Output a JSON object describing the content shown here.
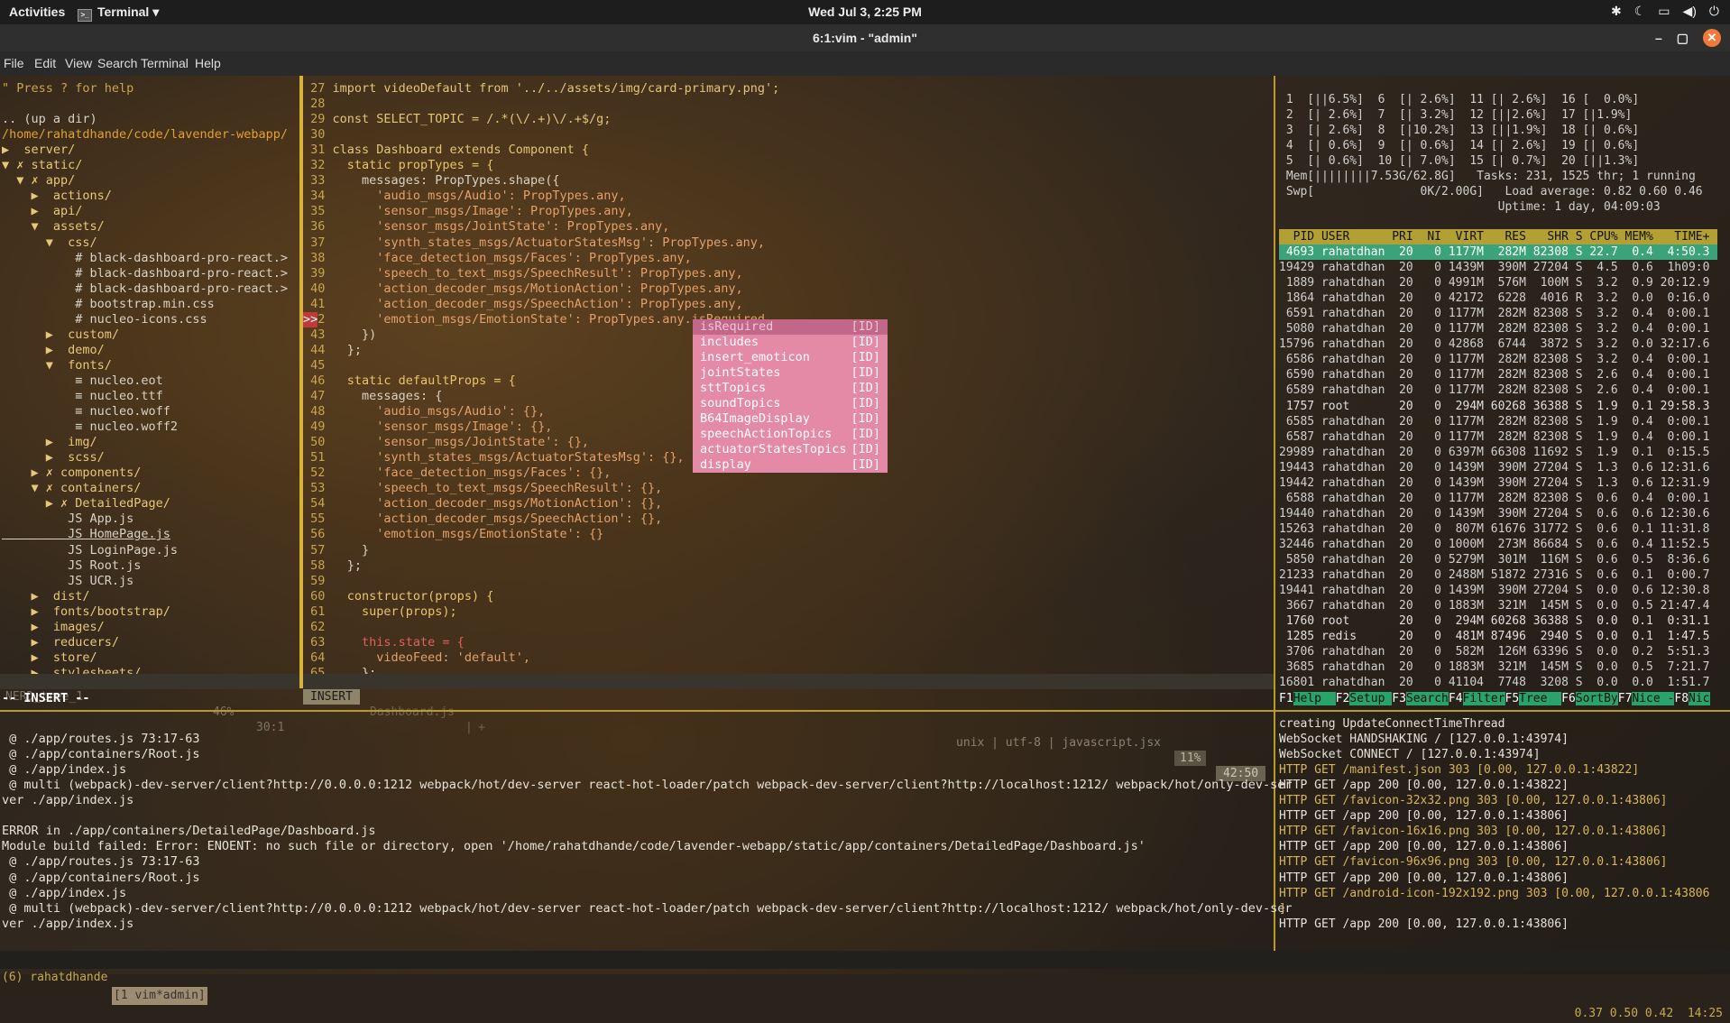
{
  "topbar": {
    "activities": "Activities",
    "app": "Terminal",
    "clock": "Wed Jul 3,  2:25 PM"
  },
  "window": {
    "title": "6:1:vim - \"admin\""
  },
  "menu": [
    "File",
    "Edit",
    "View",
    "Search",
    "Terminal",
    "Help"
  ],
  "nerdtree": {
    "lines": [
      "\" Press ? for help",
      "",
      ".. (up a dir)",
      "/home/rahatdhande/code/lavender-webapp/",
      "▶  server/",
      "▼ ✗ static/",
      "  ▼ ✗ app/",
      "    ▶  actions/",
      "    ▶  api/",
      "    ▼  assets/",
      "      ▼  css/",
      "          # black-dashboard-pro-react.>",
      "          # black-dashboard-pro-react.>",
      "          # black-dashboard-pro-react.>",
      "          # bootstrap.min.css",
      "          # nucleo-icons.css",
      "      ▶  custom/",
      "      ▶  demo/",
      "      ▼  fonts/",
      "          ≡ nucleo.eot",
      "          ≡ nucleo.ttf",
      "          ≡ nucleo.woff",
      "          ≡ nucleo.woff2",
      "      ▶  img/",
      "      ▶  scss/",
      "    ▶ ✗ components/",
      "    ▼ ✗ containers/",
      "      ▶ ✗ DetailedPage/",
      "         JS App.js",
      "         JS HomePage.js",
      "         JS LoginPage.js",
      "         JS Root.js",
      "         JS UCR.js",
      "    ▶  dist/",
      "    ▶  fonts/bootstrap/",
      "    ▶  images/",
      "    ▶  reducers/",
      "    ▶  store/",
      "    ▶  stylesheets/"
    ],
    "status_left": "NERD_tree_1",
    "status_pct": "46%",
    "status_pos": "30:1"
  },
  "code": {
    "start": 27,
    "lines": [
      "import videoDefault from '../../assets/img/card-primary.png';",
      "",
      "const SELECT_TOPIC = /.*(\\/.+)\\/.+$/g;",
      "",
      "class Dashboard extends Component {",
      "  static propTypes = {",
      "    messages: PropTypes.shape({",
      "      'audio_msgs/Audio': PropTypes.any,",
      "      'sensor_msgs/Image': PropTypes.any,",
      "      'sensor_msgs/JointState': PropTypes.any,",
      "      'synth_states_msgs/ActuatorStatesMsg': PropTypes.any,",
      "      'face_detection_msgs/Faces': PropTypes.any,",
      "      'speech_to_text_msgs/SpeechResult': PropTypes.any,",
      "      'action_decoder_msgs/MotionAction': PropTypes.any,",
      "      'action_decoder_msgs/SpeechAction': PropTypes.any,",
      "      'emotion_msgs/EmotionState': PropTypes.any.isRequired",
      "    })",
      "  };",
      "",
      "  static defaultProps = {",
      "    messages: {",
      "      'audio_msgs/Audio': {},",
      "      'sensor_msgs/Image': {},",
      "      'sensor_msgs/JointState': {},",
      "      'synth_states_msgs/ActuatorStatesMsg': {},",
      "      'face_detection_msgs/Faces': {},",
      "      'speech_to_text_msgs/SpeechResult': {},",
      "      'action_decoder_msgs/MotionAction': {},",
      "      'action_decoder_msgs/SpeechAction': {},",
      "      'emotion_msgs/EmotionState': {}",
      "    }",
      "  };",
      "",
      "  constructor(props) {",
      "    super(props);",
      "",
      "    this.state = {",
      "      videoFeed: 'default',",
      "    };"
    ],
    "sign_marker": ">>",
    "mode": "INSERT",
    "file": "Dashboard.js",
    "file_suffix": "+",
    "fileinfo": "unix | utf-8 | javascript.jsx",
    "pct": "11%",
    "pos": "42:50",
    "cmdline": "-- INSERT --"
  },
  "completion": [
    {
      "word": "isRequired",
      "kind": "[ID]"
    },
    {
      "word": "includes",
      "kind": "[ID]"
    },
    {
      "word": "insert_emoticon",
      "kind": "[ID]"
    },
    {
      "word": "jointStates",
      "kind": "[ID]"
    },
    {
      "word": "sttTopics",
      "kind": "[ID]"
    },
    {
      "word": "soundTopics",
      "kind": "[ID]"
    },
    {
      "word": "B64ImageDisplay",
      "kind": "[ID]"
    },
    {
      "word": "speechActionTopics",
      "kind": "[ID]"
    },
    {
      "word": "actuatorStatesTopics",
      "kind": "[ID]"
    },
    {
      "word": "display",
      "kind": "[ID]"
    }
  ],
  "htop": {
    "cpus": [
      " 1  [||6.5%]  6  [| 2.6%]  11 [| 2.6%]  16 [  0.0%]",
      " 2  [| 2.6%]  7  [| 3.2%]  12 [||2.6%]  17 [|1.9%]",
      " 3  [| 2.6%]  8  [|10.2%]  13 [||1.9%]  18 [| 0.6%]",
      " 4  [| 0.6%]  9  [| 0.6%]  14 [| 2.6%]  19 [| 0.6%]",
      " 5  [| 0.6%]  10 [| 7.0%]  15 [| 0.7%]  20 [||1.3%]"
    ],
    "mem": " Mem[||||||||7.53G/62.8G]   Tasks: 231, 1525 thr; 1 running",
    "swp": " Swp[               0K/2.00G]   Load average: 0.82 0.60 0.46",
    "uptime": "                               Uptime: 1 day, 04:09:03",
    "header": "  PID USER      PRI  NI  VIRT   RES   SHR S CPU% MEM%   TIME+",
    "rows": [
      " 4693 rahatdhan  20   0 1177M  282M 82308 S 22.7  0.4  4:50.3",
      "19429 rahatdhan  20   0 1439M  390M 27204 S  4.5  0.6  1h09:0",
      " 1889 rahatdhan  20   0 4991M  576M  100M S  3.2  0.9 20:12.9",
      " 1864 rahatdhan  20   0 42172  6228  4016 R  3.2  0.0  0:16.0",
      " 6591 rahatdhan  20   0 1177M  282M 82308 S  3.2  0.4  0:00.1",
      " 5080 rahatdhan  20   0 1177M  282M 82308 S  3.2  0.4  0:00.1",
      "15796 rahatdhan  20   0 42868  6744  3872 S  3.2  0.0 32:17.6",
      " 6586 rahatdhan  20   0 1177M  282M 82308 S  3.2  0.4  0:00.1",
      " 6590 rahatdhan  20   0 1177M  282M 82308 S  2.6  0.4  0:00.1",
      " 6589 rahatdhan  20   0 1177M  282M 82308 S  2.6  0.4  0:00.1",
      " 1757 root       20   0  294M 60268 36388 S  1.9  0.1 29:58.3",
      " 6585 rahatdhan  20   0 1177M  282M 82308 S  1.9  0.4  0:00.1",
      " 6587 rahatdhan  20   0 1177M  282M 82308 S  1.9  0.4  0:00.1",
      "29989 rahatdhan  20   0 6397M 66308 11692 S  1.9  0.1  0:15.5",
      "19443 rahatdhan  20   0 1439M  390M 27204 S  1.3  0.6 12:31.6",
      "19442 rahatdhan  20   0 1439M  390M 27204 S  1.3  0.6 12:31.9",
      " 6588 rahatdhan  20   0 1177M  282M 82308 S  0.6  0.4  0:00.1",
      "19440 rahatdhan  20   0 1439M  390M 27204 S  0.6  0.6 12:30.6",
      "15263 rahatdhan  20   0  807M 61676 31772 S  0.6  0.1 11:31.8",
      "32446 rahatdhan  20   0 1000M  273M 86684 S  0.6  0.4 11:52.5",
      " 5850 rahatdhan  20   0 5279M  301M  116M S  0.6  0.5  8:36.6",
      "21233 rahatdhan  20   0 2488M 51872 27316 S  0.6  0.1  0:00.7",
      "19441 rahatdhan  20   0 1439M  390M 27204 S  0.0  0.6 12:30.8",
      " 3667 rahatdhan  20   0 1883M  321M  145M S  0.0  0.5 21:47.4",
      " 1760 root       20   0  294M 60268 36388 S  0.0  0.1  0:31.1",
      " 1285 redis      20   0  481M 87496  2940 S  0.0  0.1  1:47.5",
      " 3706 rahatdhan  20   0  582M  126M 63396 S  0.0  0.2  5:51.3",
      " 3685 rahatdhan  20   0 1883M  321M  145M S  0.0  0.5  7:21.7",
      "16801 rahatdhan  20   0 41104  7748  3208 S  0.0  0.0  1:51.7"
    ],
    "fkeys": [
      {
        "k": "F1",
        "l": "Help  "
      },
      {
        "k": "F2",
        "l": "Setup "
      },
      {
        "k": "F3",
        "l": "Search"
      },
      {
        "k": "F4",
        "l": "Filter"
      },
      {
        "k": "F5",
        "l": "Tree  "
      },
      {
        "k": "F6",
        "l": "SortBy"
      },
      {
        "k": "F7",
        "l": "Nice -"
      },
      {
        "k": "F8",
        "l": "Nic"
      }
    ]
  },
  "log": {
    "lines": [
      "",
      " @ ./app/routes.js 73:17-63",
      " @ ./app/containers/Root.js",
      " @ ./app/index.js",
      " @ multi (webpack)-dev-server/client?http://0.0.0.0:1212 webpack/hot/dev-server react-hot-loader/patch webpack-dev-server/client?http://localhost:1212/ webpack/hot/only-dev-ser",
      "ver ./app/index.js",
      "",
      "ERROR in ./app/containers/DetailedPage/Dashboard.js",
      "Module build failed: Error: ENOENT: no such file or directory, open '/home/rahatdhande/code/lavender-webapp/static/app/containers/DetailedPage/Dashboard.js'",
      " @ ./app/routes.js 73:17-63",
      " @ ./app/containers/Root.js",
      " @ ./app/index.js",
      " @ multi (webpack)-dev-server/client?http://0.0.0.0:1212 webpack/hot/dev-server react-hot-loader/patch webpack-dev-server/client?http://localhost:1212/ webpack/hot/only-dev-ser",
      "ver ./app/index.js"
    ]
  },
  "server": {
    "lines": [
      {
        "t": "creating UpdateConnectTimeThread",
        "c": "n"
      },
      {
        "t": "WebSocket HANDSHAKING / [127.0.0.1:43974]",
        "c": "n"
      },
      {
        "t": "WebSocket CONNECT / [127.0.0.1:43974]",
        "c": "n"
      },
      {
        "t": "HTTP GET /manifest.json 303 [0.00, 127.0.0.1:43822]",
        "c": "y"
      },
      {
        "t": "HTTP GET /app 200 [0.00, 127.0.0.1:43822]",
        "c": "n"
      },
      {
        "t": "HTTP GET /favicon-32x32.png 303 [0.00, 127.0.0.1:43806]",
        "c": "y"
      },
      {
        "t": "HTTP GET /app 200 [0.00, 127.0.0.1:43806]",
        "c": "n"
      },
      {
        "t": "HTTP GET /favicon-16x16.png 303 [0.00, 127.0.0.1:43806]",
        "c": "y"
      },
      {
        "t": "HTTP GET /app 200 [0.00, 127.0.0.1:43806]",
        "c": "n"
      },
      {
        "t": "HTTP GET /favicon-96x96.png 303 [0.00, 127.0.0.1:43806]",
        "c": "y"
      },
      {
        "t": "HTTP GET /app 200 [0.00, 127.0.0.1:43806]",
        "c": "n"
      },
      {
        "t": "HTTP GET /android-icon-192x192.png 303 [0.00, 127.0.0.1:43806",
        "c": "y"
      },
      {
        "t": "]",
        "c": "y"
      },
      {
        "t": "HTTP GET /app 200 [0.00, 127.0.0.1:43806]",
        "c": "n"
      }
    ]
  },
  "tmux": {
    "session": "(6) rahatdhande",
    "window": "[1 vim*admin]",
    "right": "0.37 0.50 0.42  14:25"
  }
}
